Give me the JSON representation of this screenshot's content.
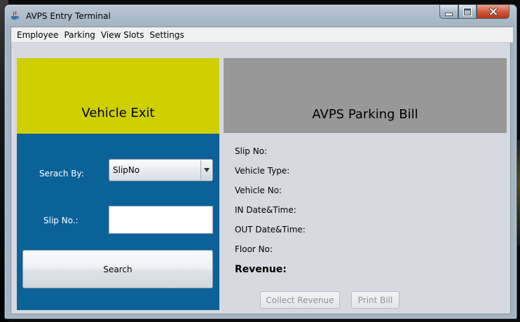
{
  "window": {
    "title": "AVPS Entry Terminal"
  },
  "menu": [
    "Employee",
    "Parking",
    "View Slots",
    "Settings"
  ],
  "exit_panel": {
    "title": "Vehicle Exit",
    "search_by_label": "Serach By:",
    "search_by_value": "SlipNo",
    "slip_label": "Slip No.:",
    "slip_value": "",
    "search_button": "Search"
  },
  "bill": {
    "title": "AVPS Parking Bill",
    "fields": [
      "Slip No:",
      "Vehicle Type:",
      "Vehicle No:",
      "IN Date&Time:",
      "OUT Date&Time:",
      "Floor No:"
    ],
    "revenue_label": "Revenue:",
    "collect_button": "Collect Revenue",
    "print_button": "Print Bill"
  },
  "colors": {
    "exit_header": "#cfcf00",
    "exit_panel": "#0b6299",
    "bill_header": "#989898",
    "client_bg": "#d6d9df"
  },
  "icons": [
    "java-app-icon",
    "minimize-icon",
    "maximize-icon",
    "close-icon",
    "chevron-down-icon"
  ]
}
